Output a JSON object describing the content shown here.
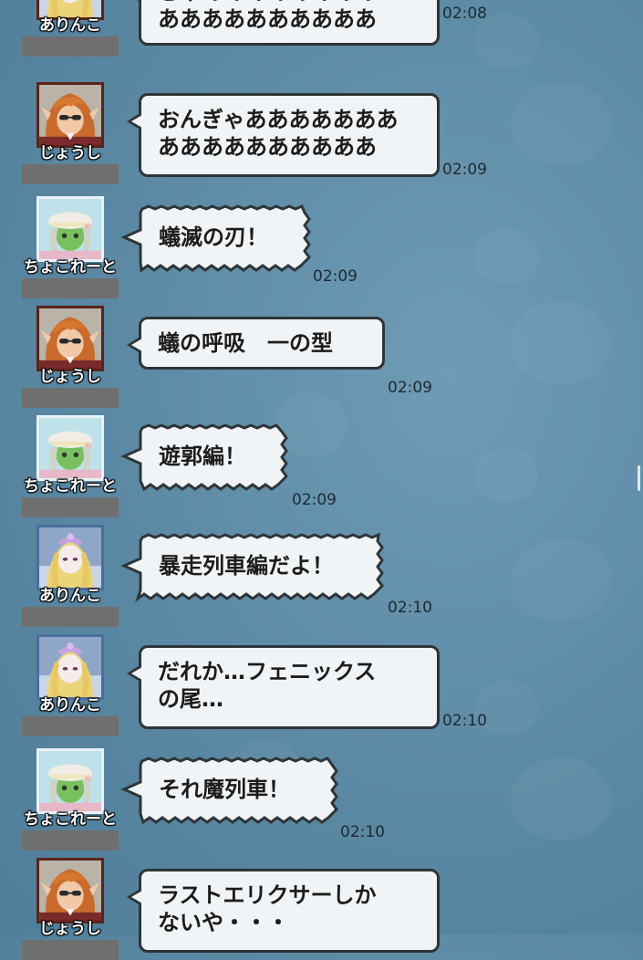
{
  "messages": [
    {
      "name": "ありんこ",
      "text": [
        "きゃああああああああ",
        "ああああああああああ"
      ],
      "time": "02:08",
      "avatar": "arinko"
    },
    {
      "name": "じょうし",
      "text": [
        "おんぎゃあああああああ",
        "ああああああああああ"
      ],
      "time": "02:09",
      "avatar": "joushi"
    },
    {
      "name": "ちょこれーと",
      "text": [
        "蟻滅の刃！"
      ],
      "time": "02:09",
      "avatar": "chocolate"
    },
    {
      "name": "じょうし",
      "text": [
        "蟻の呼吸　一の型"
      ],
      "time": "02:09",
      "avatar": "joushi"
    },
    {
      "name": "ちょこれーと",
      "text": [
        "遊郭編！"
      ],
      "time": "02:09",
      "avatar": "chocolate"
    },
    {
      "name": "ありんこ",
      "text": [
        "暴走列車編だよ！"
      ],
      "time": "02:10",
      "avatar": "arinko"
    },
    {
      "name": "ありんこ",
      "text": [
        "だれか…フェニックス",
        "の尾…"
      ],
      "time": "02:10",
      "avatar": "arinko"
    },
    {
      "name": "ちょこれーと",
      "text": [
        "それ魔列車！"
      ],
      "time": "02:10",
      "avatar": "chocolate"
    },
    {
      "name": "じょうし",
      "text": [
        "ラストエリクサーしか",
        "ないや・・・"
      ],
      "time": "",
      "avatar": "joushi"
    }
  ],
  "colors": {
    "background": "#5b88a3",
    "bubble": "#f1f4f6",
    "bubble_border": "#2e3538",
    "redaction": "#6f6f6f"
  }
}
